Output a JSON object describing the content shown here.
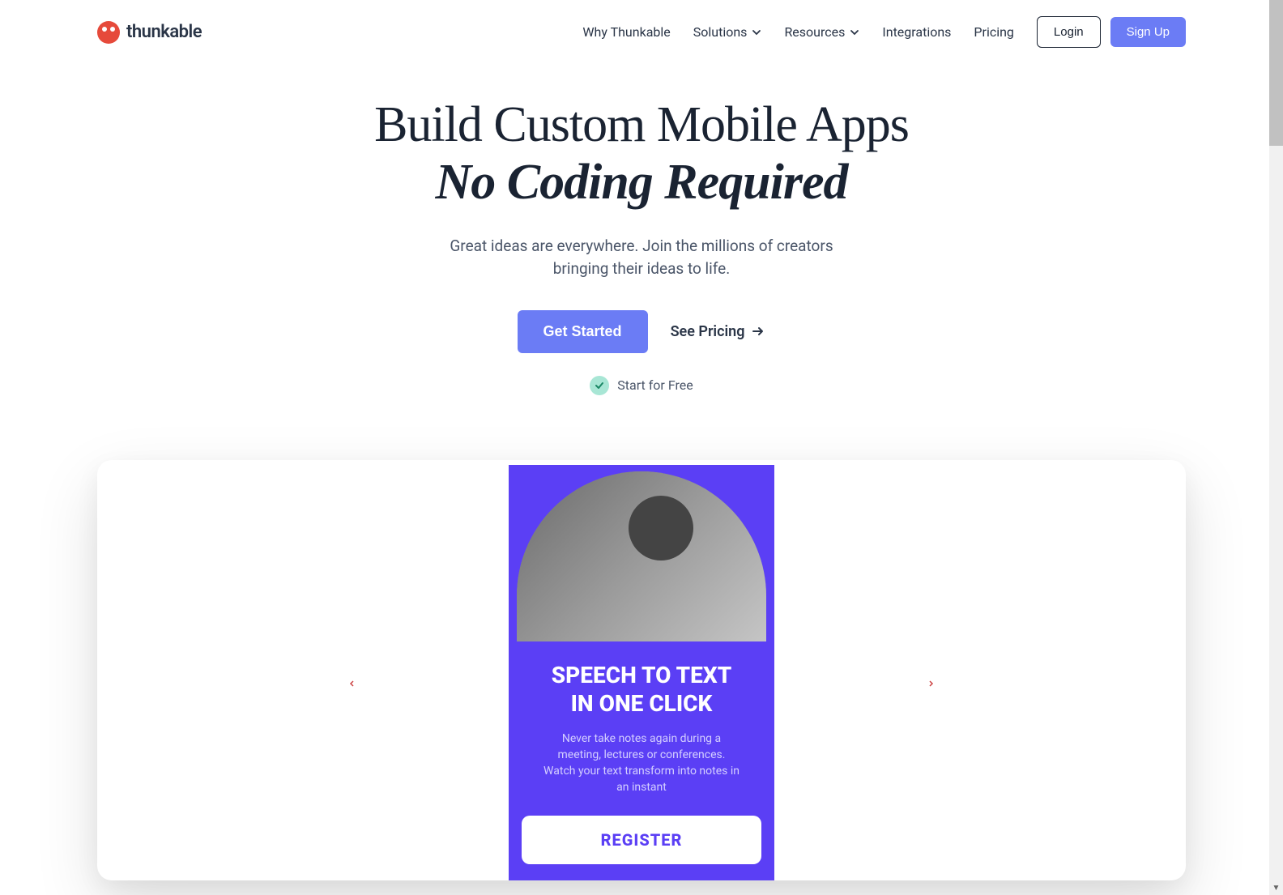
{
  "nav": {
    "brand": "thunkable",
    "links": {
      "why": "Why Thunkable",
      "solutions": "Solutions",
      "resources": "Resources",
      "integrations": "Integrations",
      "pricing": "Pricing"
    },
    "login": "Login",
    "signup": "Sign Up"
  },
  "hero": {
    "title_line1": "Build Custom Mobile Apps",
    "title_line2": "No Coding Required",
    "subtitle": "Great ideas are everywhere. Join the millions of creators bringing their ideas to life.",
    "get_started": "Get Started",
    "see_pricing": "See Pricing",
    "start_free": "Start for Free"
  },
  "phone": {
    "title_line1": "SPEECH TO TEXT",
    "title_line2": "IN ONE CLICK",
    "desc": "Never take notes again during a meeting, lectures or conferences. Watch your text transform into notes in an instant",
    "button": "REGISTER"
  }
}
